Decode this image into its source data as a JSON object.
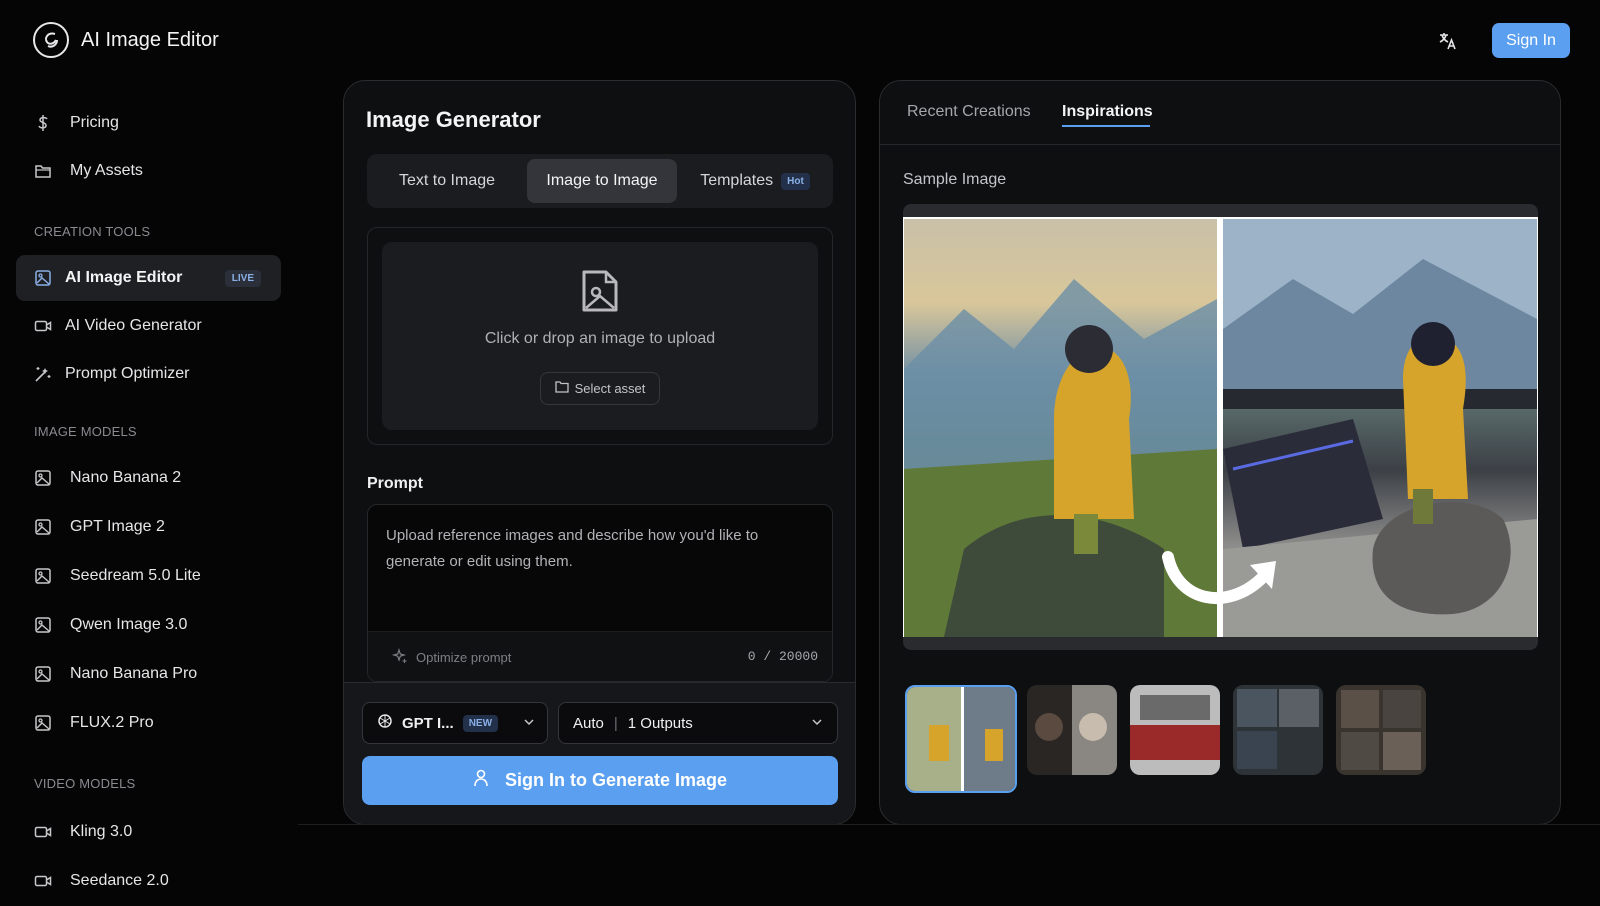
{
  "header": {
    "app_title": "AI Image Editor",
    "sign_in_label": "Sign In"
  },
  "sidebar": {
    "top_items": [
      {
        "label": "Pricing",
        "icon": "dollar-icon"
      },
      {
        "label": "My Assets",
        "icon": "folder-icon"
      }
    ],
    "creation_tools_label": "CREATION TOOLS",
    "creation_tools": [
      {
        "label": "AI Image Editor",
        "icon": "image-icon",
        "badge": "LIVE",
        "active": true
      },
      {
        "label": "AI Video Generator",
        "icon": "video-icon"
      },
      {
        "label": "Prompt Optimizer",
        "icon": "magic-wand-icon"
      }
    ],
    "image_models_label": "IMAGE MODELS",
    "image_models": [
      {
        "label": "Nano Banana 2"
      },
      {
        "label": "GPT Image 2"
      },
      {
        "label": "Seedream 5.0 Lite"
      },
      {
        "label": "Qwen Image 3.0"
      },
      {
        "label": "Nano Banana Pro"
      },
      {
        "label": "FLUX.2 Pro"
      }
    ],
    "video_models_label": "VIDEO MODELS",
    "video_models": [
      {
        "label": "Kling 3.0"
      },
      {
        "label": "Seedance 2.0"
      }
    ]
  },
  "generator": {
    "title": "Image Generator",
    "tabs": [
      {
        "label": "Text to Image"
      },
      {
        "label": "Image to Image",
        "active": true
      },
      {
        "label": "Templates",
        "badge": "Hot"
      }
    ],
    "upload_text": "Click or drop an image to upload",
    "select_asset_label": "Select asset",
    "prompt_label": "Prompt",
    "prompt_placeholder": "Upload reference images and describe how you'd like to generate or edit using them.",
    "optimize_label": "Optimize prompt",
    "char_count": "0 / 20000",
    "model_label": "GPT I...",
    "model_badge": "NEW",
    "aspect_label": "Auto",
    "outputs_label": "1 Outputs",
    "generate_label": "Sign In to Generate Image"
  },
  "right_panel": {
    "tabs": [
      {
        "label": "Recent Creations"
      },
      {
        "label": "Inspirations",
        "active": true
      }
    ],
    "sample_label": "Sample Image",
    "thumbnail_count": 5
  },
  "colors": {
    "accent": "#5b9ff0",
    "background": "#050506",
    "panel": "#0e0f11",
    "figure": "#d6a42a"
  }
}
